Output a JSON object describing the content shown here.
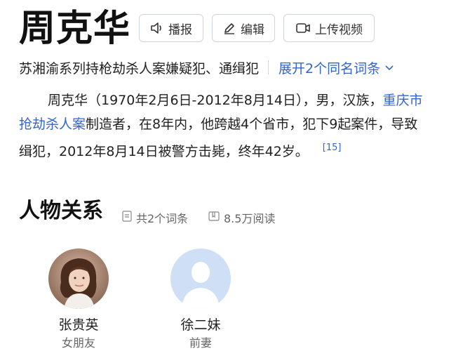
{
  "header": {
    "title": "周克华",
    "buttons": {
      "play": "播报",
      "edit": "编辑",
      "upload_video": "上传视频"
    }
  },
  "subtitle": {
    "text": "苏湘渝系列持枪劫杀人案嫌疑犯、通缉犯",
    "same_name_link": "展开2个同名词条"
  },
  "summary": {
    "line1_text": "周克华（1970年2月6日-2012年8月14日），男，汉族，",
    "line1_link": "重庆市",
    "line2_link": "抢劫杀人案",
    "line2_text": "制造者，在8年内，他跨越4个省市，犯下9起案件，导致",
    "line3_text": "缉犯，2012年8月14日被警方击毙，终年42岁。",
    "reference": "[15]"
  },
  "relations": {
    "title": "人物关系",
    "entries_count": "共2个词条",
    "views": "8.5万阅读",
    "people": [
      {
        "name": "张贵英",
        "relation": "女朋友"
      },
      {
        "name": "徐二妹",
        "relation": "前妻"
      }
    ]
  },
  "colors": {
    "link": "#3366cc",
    "text": "#222222",
    "muted": "#666666",
    "border": "#cfd3da"
  }
}
